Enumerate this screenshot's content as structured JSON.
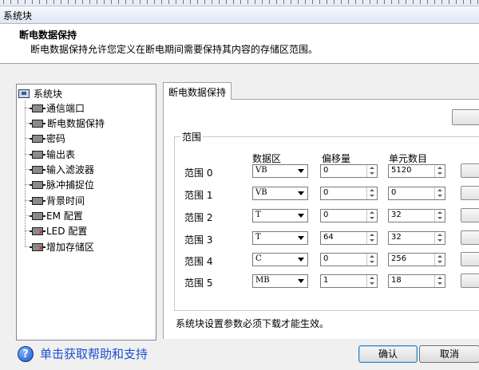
{
  "window": {
    "title": "系统块"
  },
  "header": {
    "title": "断电数据保持",
    "description": "断电数据保持允许您定义在断电期间需要保持其内容的存储区范围。"
  },
  "tree": {
    "root": "系统块",
    "items": [
      {
        "label": "通信端口",
        "icon": "module-icon"
      },
      {
        "label": "断电数据保持",
        "icon": "module-icon",
        "selected": true
      },
      {
        "label": "密码",
        "icon": "module-icon"
      },
      {
        "label": "输出表",
        "icon": "module-icon"
      },
      {
        "label": "输入滤波器",
        "icon": "module-icon"
      },
      {
        "label": "脉冲捕捉位",
        "icon": "module-icon"
      },
      {
        "label": "背景时间",
        "icon": "module-icon"
      },
      {
        "label": "EM 配置",
        "icon": "module-icon"
      },
      {
        "label": "LED 配置",
        "icon": "module-error-icon"
      },
      {
        "label": "增加存储区",
        "icon": "module-error-icon"
      }
    ]
  },
  "tab": {
    "label": "断电数据保持"
  },
  "group": {
    "label": "范围",
    "columns": {
      "area": "数据区",
      "offset": "偏移量",
      "count": "单元数目"
    },
    "rows": [
      {
        "label": "范围 0",
        "area": "VB",
        "offset": "0",
        "count": "5120"
      },
      {
        "label": "范围 1",
        "area": "VB",
        "offset": "0",
        "count": "0"
      },
      {
        "label": "范围 2",
        "area": "T",
        "offset": "0",
        "count": "32"
      },
      {
        "label": "范围 3",
        "area": "T",
        "offset": "64",
        "count": "32"
      },
      {
        "label": "范围 4",
        "area": "C",
        "offset": "0",
        "count": "256"
      },
      {
        "label": "范围 5",
        "area": "MB",
        "offset": "1",
        "count": "18"
      }
    ]
  },
  "note": "系统块设置参数必须下载才能生效。",
  "footer": {
    "help": "单击获取帮助和支持",
    "ok": "确认",
    "cancel": "取消"
  }
}
